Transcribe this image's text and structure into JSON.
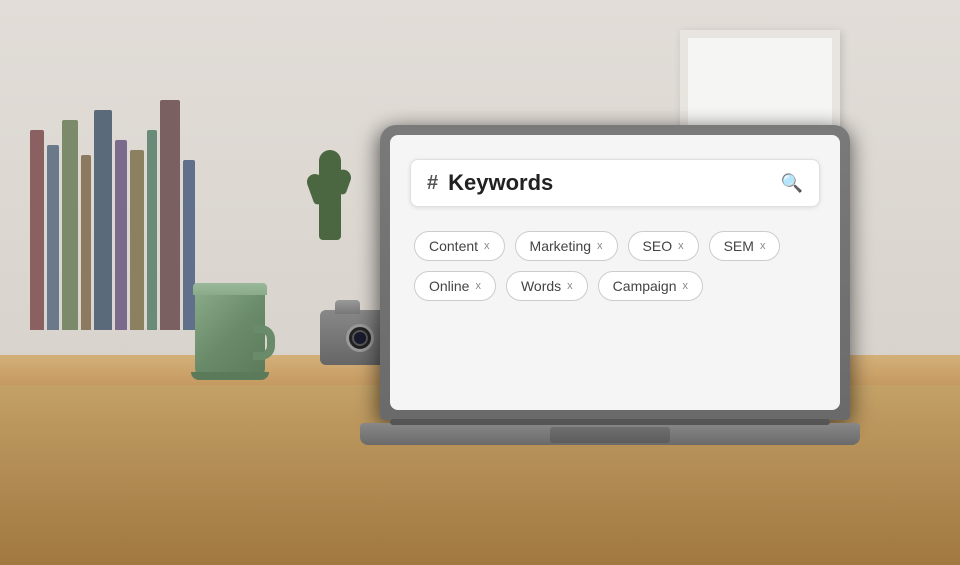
{
  "scene": {
    "title": "Keywords search UI on laptop"
  },
  "screen": {
    "search": {
      "hash_symbol": "#",
      "placeholder": "Keywords",
      "search_icon": "🔍"
    },
    "tags": [
      {
        "label": "Content",
        "close": "x"
      },
      {
        "label": "Marketing",
        "close": "x"
      },
      {
        "label": "SEO",
        "close": "x"
      },
      {
        "label": "SEM",
        "close": "x"
      },
      {
        "label": "Online",
        "close": "x"
      },
      {
        "label": "Words",
        "close": "x"
      },
      {
        "label": "Campaign",
        "close": "x"
      }
    ]
  }
}
